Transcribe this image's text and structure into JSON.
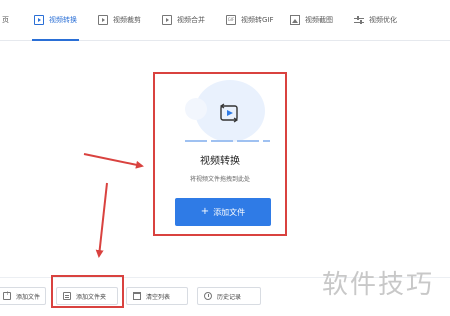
{
  "tabs": [
    {
      "label": "页",
      "icon": "home-icon"
    },
    {
      "label": "视频转换",
      "icon": "video-convert-icon",
      "active": true
    },
    {
      "label": "视频裁剪",
      "icon": "video-crop-icon"
    },
    {
      "label": "视频合并",
      "icon": "video-merge-icon"
    },
    {
      "label": "视频转GIF",
      "icon": "gif-icon"
    },
    {
      "label": "视频截图",
      "icon": "screenshot-icon"
    },
    {
      "label": "视频优化",
      "icon": "optimize-icon"
    }
  ],
  "upload": {
    "title": "视频转换",
    "subtitle": "将视频文件拖拽到此处",
    "add_button": "添加文件",
    "add_button_prefix": "+"
  },
  "bottom": {
    "add_file": "添加文件",
    "add_folder": "添加文件夹",
    "clear_list": "清空列表",
    "history": "历史记录"
  },
  "watermark": "软件技巧",
  "colors": {
    "accent": "#2f7be6",
    "annotation": "#d9423f"
  }
}
